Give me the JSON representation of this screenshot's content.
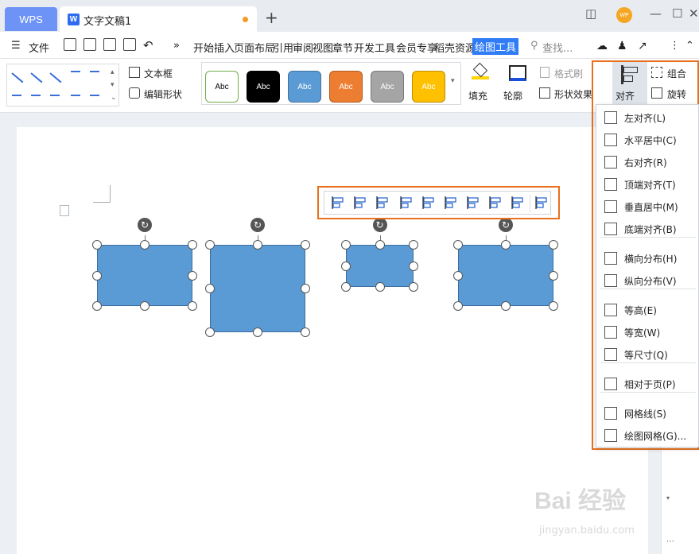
{
  "titlebar": {
    "app_tab": "WPS",
    "doc_tab": "文字文稿1",
    "new_tab": "+",
    "avatar_text": "WP"
  },
  "menubar": {
    "file": "文件",
    "tabs": [
      "开始",
      "插入",
      "页面布局",
      "引用",
      "审阅",
      "视图",
      "章节",
      "开发工具",
      "会员专享",
      "稻壳资源"
    ],
    "active_tab": "绘图工具",
    "search": "查找..."
  },
  "ribbon": {
    "text_box": "文本框",
    "edit_shape": "编辑形状",
    "styles": [
      {
        "label": "Abc",
        "fill": "#ffffff",
        "border": "#70ad47",
        "text": "#000000"
      },
      {
        "label": "Abc",
        "fill": "#000000",
        "border": "#000000",
        "text": "#ffffff"
      },
      {
        "label": "Abc",
        "fill": "#5b9bd5",
        "border": "#41719c",
        "text": "#ffffff"
      },
      {
        "label": "Abc",
        "fill": "#ed7d31",
        "border": "#ae5a21",
        "text": "#ffffff"
      },
      {
        "label": "Abc",
        "fill": "#a5a5a5",
        "border": "#787878",
        "text": "#ffffff"
      },
      {
        "label": "Abc",
        "fill": "#ffc000",
        "border": "#bc8c00",
        "text": "#ffffff"
      }
    ],
    "fill": "填充",
    "outline": "轮廓",
    "format_painter": "格式刷",
    "shape_effects": "形状效果",
    "align": "对齐",
    "group": "组合",
    "rotate": "旋转"
  },
  "align_menu": {
    "items": [
      {
        "label": "左对齐(L)",
        "icon": "align-left-icon"
      },
      {
        "label": "水平居中(C)",
        "icon": "align-center-icon"
      },
      {
        "label": "右对齐(R)",
        "icon": "align-right-icon"
      },
      {
        "label": "顶端对齐(T)",
        "icon": "align-top-icon"
      },
      {
        "label": "垂直居中(M)",
        "icon": "align-middle-icon"
      },
      {
        "label": "底端对齐(B)",
        "icon": "align-bottom-icon"
      },
      {
        "label": "横向分布(H)",
        "icon": "distribute-horizontal-icon"
      },
      {
        "label": "纵向分布(V)",
        "icon": "distribute-vertical-icon"
      },
      {
        "label": "等高(E)",
        "icon": "same-height-icon"
      },
      {
        "label": "等宽(W)",
        "icon": "same-width-icon"
      },
      {
        "label": "等尺寸(Q)",
        "icon": "same-size-icon"
      },
      {
        "label": "相对于页(P)",
        "icon": "relative-to-page-icon"
      },
      {
        "label": "网格线(S)",
        "icon": "gridlines-icon"
      },
      {
        "label": "绘图网格(G)...",
        "icon": "drawing-grid-icon"
      }
    ]
  },
  "colors": {
    "accent": "#2f7cf6",
    "highlight": "#e8711f",
    "shape_fill": "#5b9bd5"
  },
  "watermark": {
    "brand": "Bai 经验",
    "url": "jingyan.baidu.com"
  }
}
